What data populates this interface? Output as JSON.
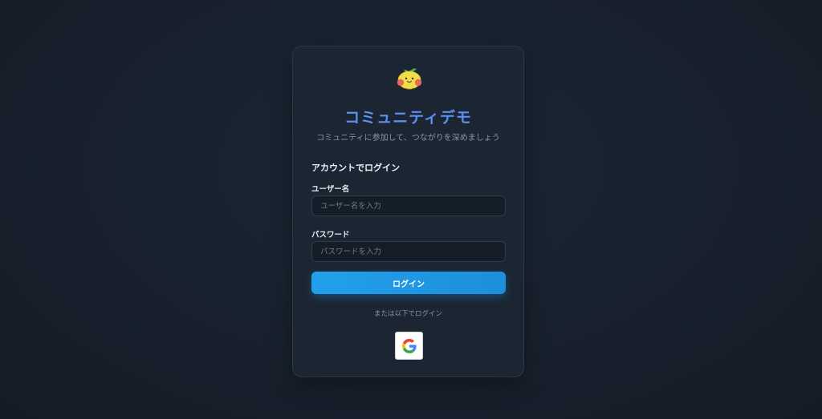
{
  "app": {
    "title": "コミュニティデモ",
    "subtitle": "コミュニティに参加して、つながりを深めましょう"
  },
  "login": {
    "section_title": "アカウントでログイン",
    "username_label": "ユーザー名",
    "username_placeholder": "ユーザー名を入力",
    "username_value": "",
    "password_label": "パスワード",
    "password_placeholder": "パスワードを入力",
    "password_value": "",
    "submit_label": "ログイン",
    "alt_login_text": "または以下でログイン"
  },
  "providers": [
    {
      "name": "google",
      "icon": "google-icon"
    }
  ],
  "colors": {
    "accent": "#5b8ff0",
    "button": "#1d97e6",
    "card": "#1b2632",
    "background": "#17202c"
  }
}
